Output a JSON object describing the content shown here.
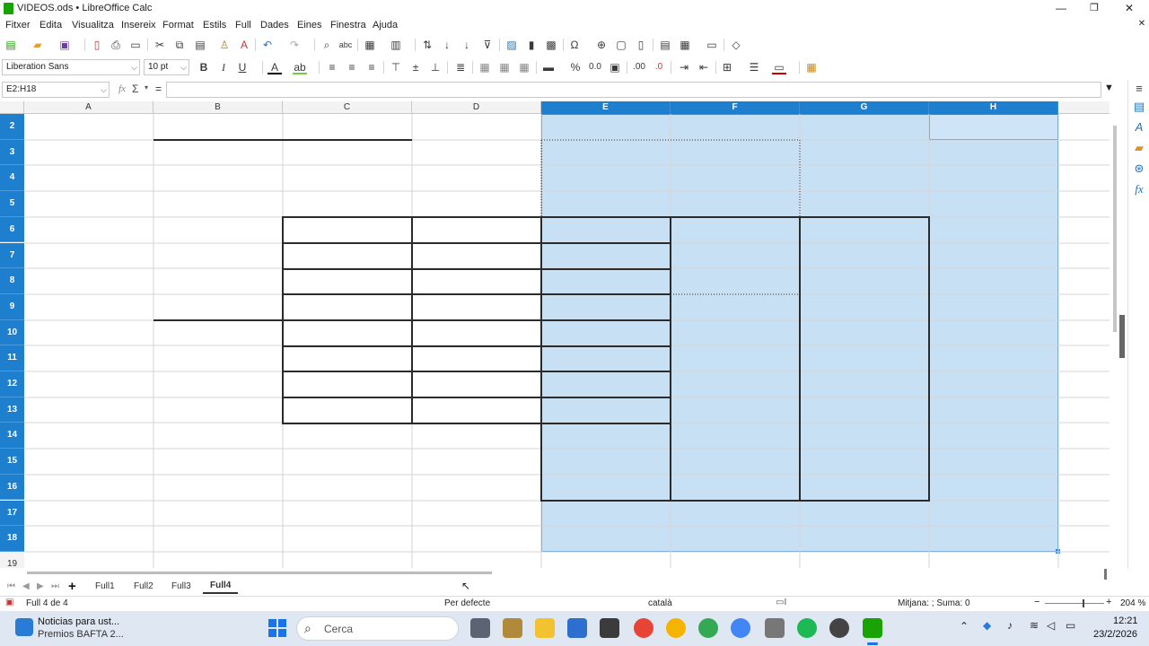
{
  "window": {
    "title": "VIDEOS.ods • LibreOffice Calc"
  },
  "menu": [
    "Fitxer",
    "Edita",
    "Visualitza",
    "Insereix",
    "Format",
    "Estils",
    "Full",
    "Dades",
    "Eines",
    "Finestra",
    "Ajuda"
  ],
  "toolbar": {
    "font_name": "Liberation Sans",
    "font_size": "10 pt"
  },
  "formula": {
    "name_box": "E2:H18",
    "fx": "fx",
    "sigma": "Σ",
    "equals": "=",
    "input_value": ""
  },
  "grid": {
    "columns": [
      "A",
      "B",
      "C",
      "D",
      "E",
      "F",
      "G",
      "H"
    ],
    "selected_columns": [
      "E",
      "F",
      "G",
      "H"
    ],
    "rows": [
      "2",
      "3",
      "4",
      "5",
      "6",
      "7",
      "8",
      "9",
      "10",
      "11",
      "12",
      "13",
      "14",
      "15",
      "16",
      "17",
      "18",
      "19"
    ],
    "selected_rows": [
      "2",
      "3",
      "4",
      "5",
      "6",
      "7",
      "8",
      "9",
      "10",
      "11",
      "12",
      "13",
      "14",
      "15",
      "16",
      "17",
      "18"
    ],
    "selection_range": "E2:H18",
    "selection_color": "#c5dff3",
    "header_selected_color": "#1f7fcf"
  },
  "tabs": {
    "add": "+",
    "sheets": [
      "Full1",
      "Full2",
      "Full3",
      "Full4"
    ],
    "active": "Full4"
  },
  "status": {
    "sheet": "Full 4 de 4",
    "page_style": "Per defecte",
    "language": "català",
    "summary": "Mitjana: ; Suma: 0",
    "zoom": "204 %"
  },
  "taskbar": {
    "news_title": "Noticias para ust...",
    "news_sub": "Premios BAFTA 2...",
    "search": "Cerca",
    "time": "12:21",
    "date": "23/2/2026"
  }
}
